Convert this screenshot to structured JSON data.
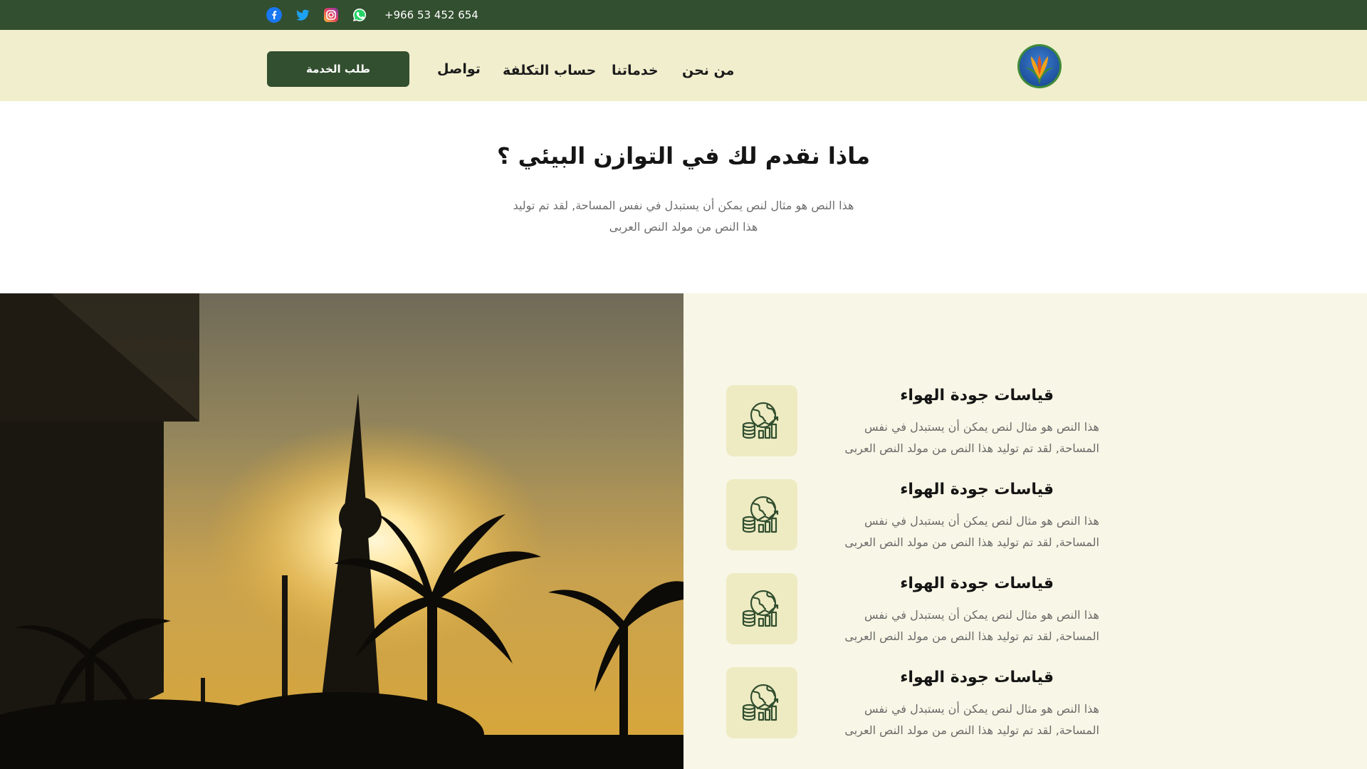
{
  "topbar": {
    "phone": "+966 53 452 654",
    "social": [
      "facebook-icon",
      "twitter-icon",
      "instagram-icon",
      "whatsapp-icon"
    ]
  },
  "header": {
    "cta_label": "طلب الخدمة",
    "nav": [
      "تواصل",
      "حساب التكلفة",
      "خدماتنا",
      "من نحن"
    ]
  },
  "intro": {
    "title": "ماذا نقدم لك في التوازن البيئي ؟",
    "text_line1": "هذا النص هو مثال لنص يمكن أن يستبدل في نفس المساحة, لقد تم توليد",
    "text_line2": "هذا النص من مولد النص العربى"
  },
  "features": [
    {
      "title": "قياسات جودة الهواء",
      "line1": "هذا النص هو مثال لنص يمكن أن يستبدل في نفس",
      "line2": "المساحة, لقد تم توليد هذا النص من مولد النص العربى",
      "icon": "globe-coins-chart-icon"
    },
    {
      "title": "قياسات جودة الهواء",
      "line1": "هذا النص هو مثال لنص يمكن أن يستبدل في نفس",
      "line2": "المساحة, لقد تم توليد هذا النص من مولد النص العربى",
      "icon": "globe-coins-chart-icon"
    },
    {
      "title": "قياسات جودة الهواء",
      "line1": "هذا النص هو مثال لنص يمكن أن يستبدل في نفس",
      "line2": "المساحة, لقد تم توليد هذا النص من مولد النص العربى",
      "icon": "globe-coins-chart-icon"
    },
    {
      "title": "قياسات جودة الهواء",
      "line1": "هذا النص هو مثال لنص يمكن أن يستبدل في نفس",
      "line2": "المساحة, لقد تم توليد هذا النص من مولد النص العربى",
      "icon": "globe-coins-chart-icon"
    }
  ],
  "colors": {
    "primary": "#324f2f",
    "header_bg": "#f1eecd",
    "features_bg": "#f8f6e6",
    "icon_tile_bg": "#eeebc3"
  }
}
